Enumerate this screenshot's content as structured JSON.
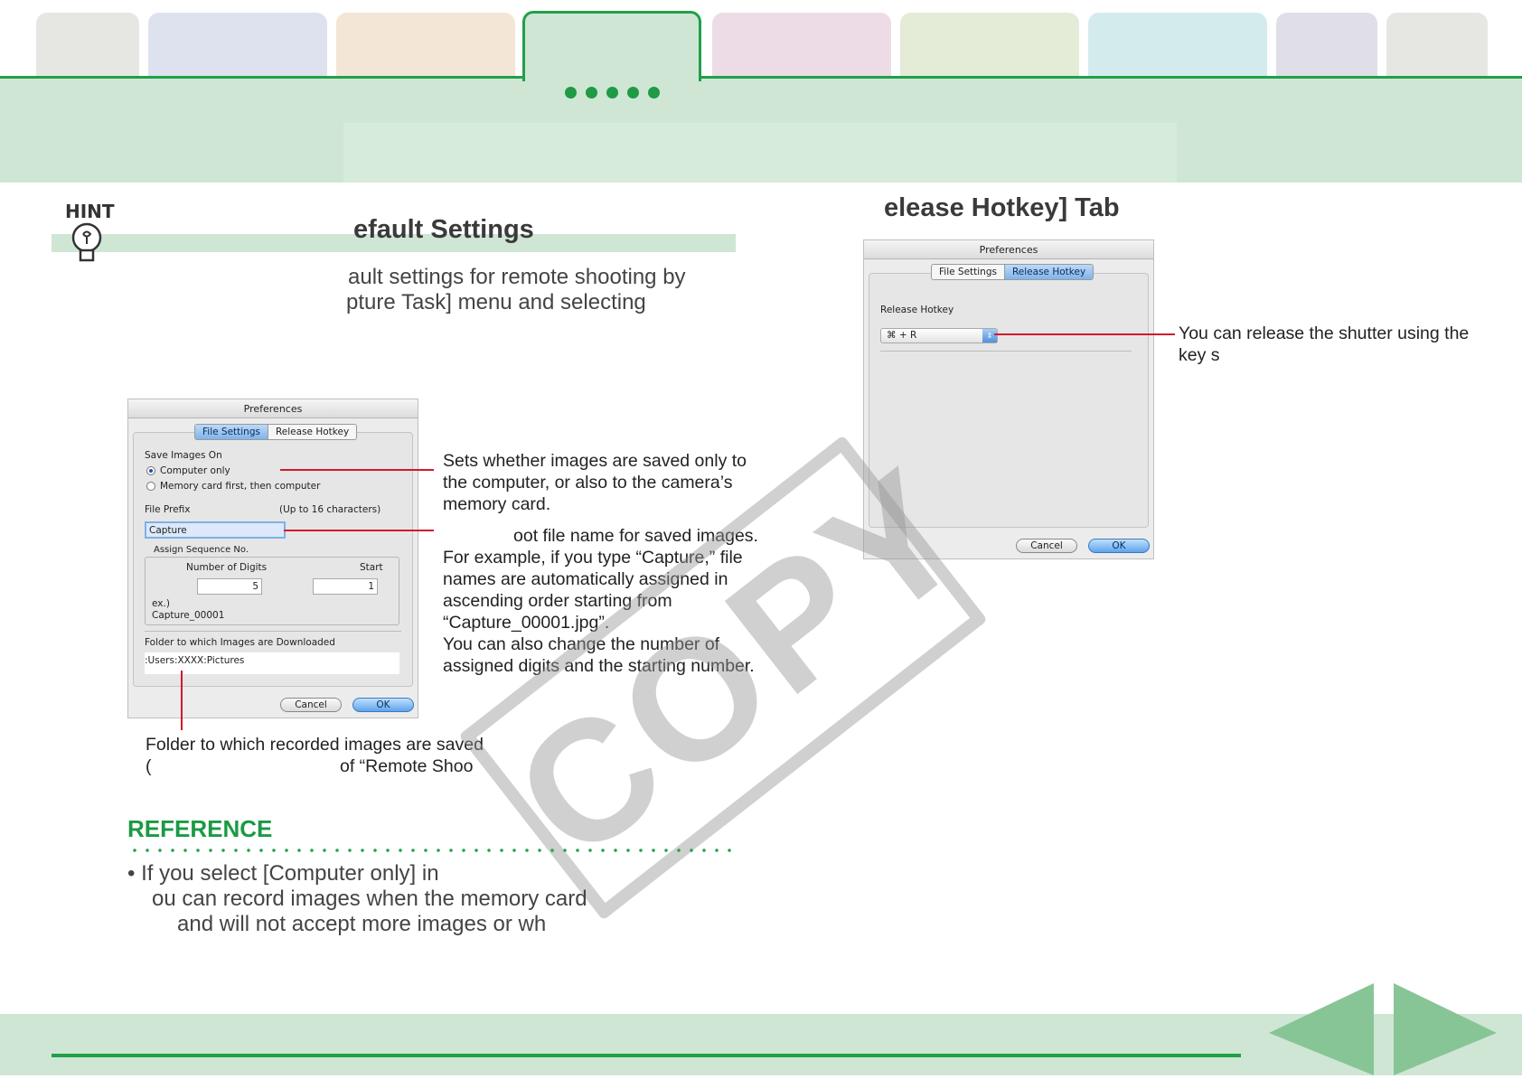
{
  "hint": {
    "label": "HINT",
    "heading": "efault Settings",
    "para_line1": "ault settings for remote shooting by",
    "para_line2": "pture Task] menu and selecting"
  },
  "right_heading": "elease Hotkey] Tab",
  "dialog_file": {
    "title": "Preferences",
    "tab_file": "File Settings",
    "tab_release": "Release Hotkey",
    "save_images_on": "Save Images On",
    "opt_computer": "Computer only",
    "opt_memory": "Memory card first, then computer",
    "file_prefix": "File Prefix",
    "prefix_limit": "(Up to 16 characters)",
    "prefix_value": "Capture",
    "assign_seq": "Assign Sequence No.",
    "num_digits": "Number of Digits",
    "start": "Start",
    "digits_value": "5",
    "start_value": "1",
    "example_label": "ex.)",
    "example_value": "Capture_00001",
    "folder_label": "Folder to which Images are Downloaded",
    "folder_value": ":Users:XXXX:Pictures",
    "cancel": "Cancel",
    "ok": "OK"
  },
  "dialog_release": {
    "title": "Preferences",
    "tab_file": "File Settings",
    "tab_release": "Release Hotkey",
    "release_hotkey": "Release Hotkey",
    "hotkey_value": "⌘ + R",
    "cancel": "Cancel",
    "ok": "OK"
  },
  "callouts": {
    "save_line1": "Sets whether images are saved only to",
    "save_line2": "the computer, or also to the camera’s",
    "save_line3": "memory card.",
    "prefix_line1": "oot file name for saved images.",
    "prefix_line2": "For example, if you type “Capture,” file",
    "prefix_line3": "names are automatically assigned in",
    "prefix_line4": "ascending order starting from",
    "prefix_line5": "“Capture_00001.jpg”.",
    "prefix_line6": "You can also change the number of",
    "prefix_line7": "assigned digits and the starting number.",
    "folder_line1": "Folder to which recorded images are saved",
    "folder_line2a": "(",
    "folder_line2b": "of “Remote Shoo",
    "hotkey_line1": "You can release the shutter using the",
    "hotkey_line2": "key s"
  },
  "watermark": "COPY",
  "reference": {
    "title": "REFERENCE",
    "line1": "• If you select [Computer only] in",
    "line2": "ou can record images when the memory card",
    "line3": "and will not accept more images or wh"
  },
  "colors": {
    "accent": "#20a04a",
    "band": "#cfe6d4",
    "callout_line": "#d11a2a"
  }
}
